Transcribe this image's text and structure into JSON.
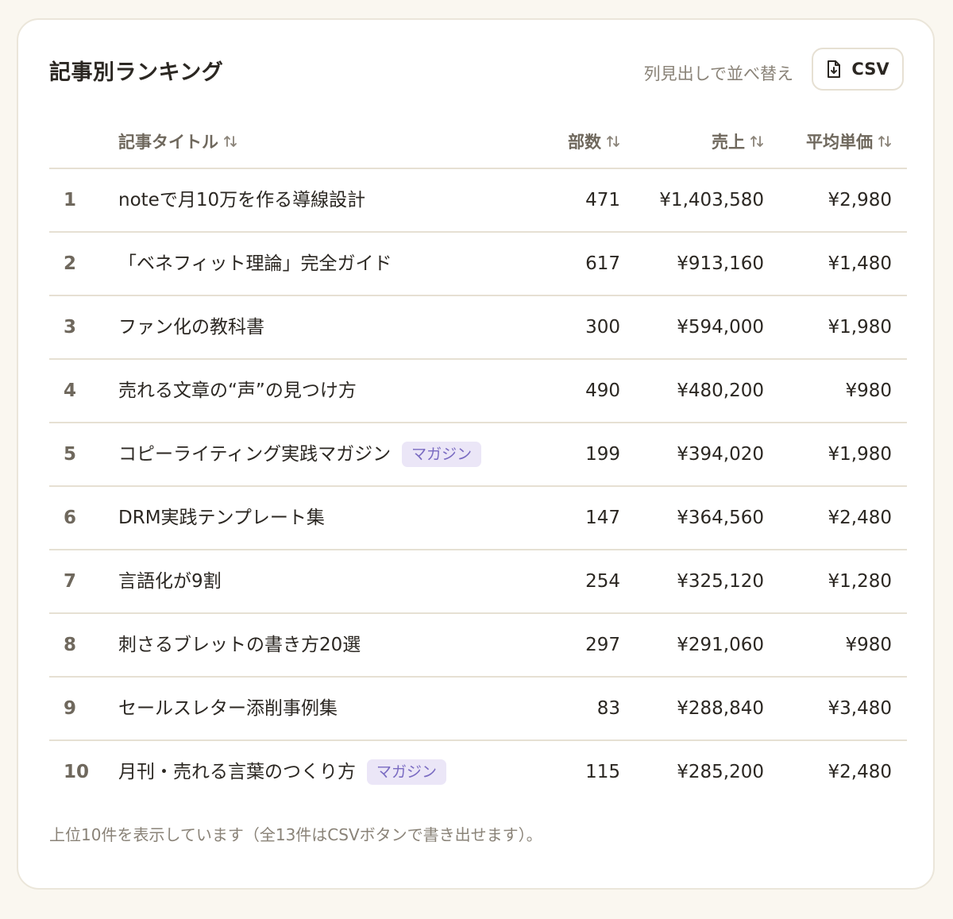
{
  "header": {
    "title": "記事別ランキング",
    "sort_hint": "列見出しで並べ替え",
    "csv_label": "CSV",
    "csv_icon": "file-download-icon"
  },
  "columns": {
    "title": "記事タイトル",
    "quantity": "部数",
    "sales": "売上",
    "avg_price": "平均単価",
    "sort_icon": "sort-arrows-icon"
  },
  "rows": [
    {
      "rank": "1",
      "title": "noteで月10万を作る導線設計",
      "tag": "",
      "quantity": "471",
      "sales": "¥1,403,580",
      "avg_price": "¥2,980"
    },
    {
      "rank": "2",
      "title": "「ベネフィット理論」完全ガイド",
      "tag": "",
      "quantity": "617",
      "sales": "¥913,160",
      "avg_price": "¥1,480"
    },
    {
      "rank": "3",
      "title": "ファン化の教科書",
      "tag": "",
      "quantity": "300",
      "sales": "¥594,000",
      "avg_price": "¥1,980"
    },
    {
      "rank": "4",
      "title": "売れる文章の“声”の見つけ方",
      "tag": "",
      "quantity": "490",
      "sales": "¥480,200",
      "avg_price": "¥980"
    },
    {
      "rank": "5",
      "title": "コピーライティング実践マガジン",
      "tag": "マガジン",
      "quantity": "199",
      "sales": "¥394,020",
      "avg_price": "¥1,980"
    },
    {
      "rank": "6",
      "title": "DRM実践テンプレート集",
      "tag": "",
      "quantity": "147",
      "sales": "¥364,560",
      "avg_price": "¥2,480"
    },
    {
      "rank": "7",
      "title": "言語化が9割",
      "tag": "",
      "quantity": "254",
      "sales": "¥325,120",
      "avg_price": "¥1,280"
    },
    {
      "rank": "8",
      "title": "刺さるブレットの書き方20選",
      "tag": "",
      "quantity": "297",
      "sales": "¥291,060",
      "avg_price": "¥980"
    },
    {
      "rank": "9",
      "title": "セールスレター添削事例集",
      "tag": "",
      "quantity": "83",
      "sales": "¥288,840",
      "avg_price": "¥3,480"
    },
    {
      "rank": "10",
      "title": "月刊・売れる言葉のつくり方",
      "tag": "マガジン",
      "quantity": "115",
      "sales": "¥285,200",
      "avg_price": "¥2,480"
    }
  ],
  "footnote": "上位10件を表示しています（全13件はCSVボタンで書き出せます）。",
  "colors": {
    "background": "#faf7f0",
    "card": "#ffffff",
    "text": "#2b2722",
    "muted": "#8a8378",
    "tag_bg": "#ebe6f7",
    "tag_text": "#7a6bc2"
  }
}
